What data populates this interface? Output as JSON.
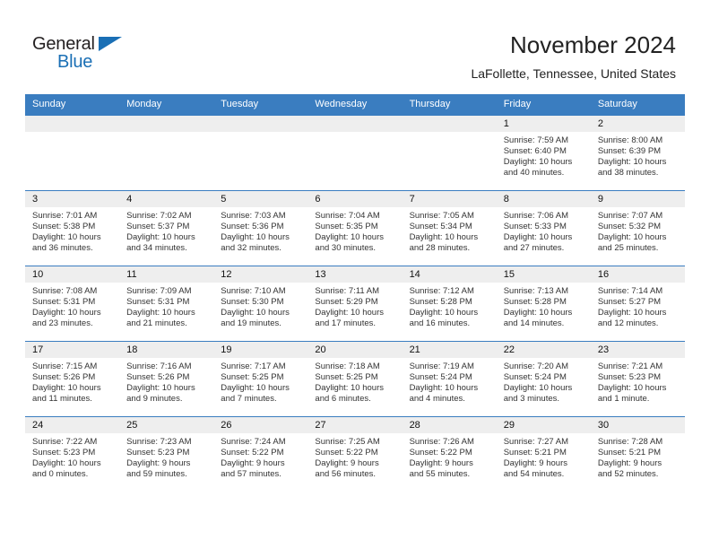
{
  "brand": {
    "name_part1": "General",
    "name_part2": "Blue",
    "accent_color": "#1a6fb5"
  },
  "header": {
    "month_title": "November 2024",
    "location": "LaFollette, Tennessee, United States"
  },
  "calendar": {
    "header_bg_color": "#3a7dc0",
    "daynum_bg_color": "#eeeeee",
    "weekday_headers": [
      "Sunday",
      "Monday",
      "Tuesday",
      "Wednesday",
      "Thursday",
      "Friday",
      "Saturday"
    ],
    "labels": {
      "sunrise_prefix": "Sunrise:",
      "sunset_prefix": "Sunset:",
      "daylight_prefix": "Daylight:"
    },
    "weeks": [
      [
        {
          "day": "",
          "empty": true
        },
        {
          "day": "",
          "empty": true
        },
        {
          "day": "",
          "empty": true
        },
        {
          "day": "",
          "empty": true
        },
        {
          "day": "",
          "empty": true
        },
        {
          "day": "1",
          "sunrise": "Sunrise: 7:59 AM",
          "sunset": "Sunset: 6:40 PM",
          "daylight_line1": "Daylight: 10 hours",
          "daylight_line2": "and 40 minutes."
        },
        {
          "day": "2",
          "sunrise": "Sunrise: 8:00 AM",
          "sunset": "Sunset: 6:39 PM",
          "daylight_line1": "Daylight: 10 hours",
          "daylight_line2": "and 38 minutes."
        }
      ],
      [
        {
          "day": "3",
          "sunrise": "Sunrise: 7:01 AM",
          "sunset": "Sunset: 5:38 PM",
          "daylight_line1": "Daylight: 10 hours",
          "daylight_line2": "and 36 minutes."
        },
        {
          "day": "4",
          "sunrise": "Sunrise: 7:02 AM",
          "sunset": "Sunset: 5:37 PM",
          "daylight_line1": "Daylight: 10 hours",
          "daylight_line2": "and 34 minutes."
        },
        {
          "day": "5",
          "sunrise": "Sunrise: 7:03 AM",
          "sunset": "Sunset: 5:36 PM",
          "daylight_line1": "Daylight: 10 hours",
          "daylight_line2": "and 32 minutes."
        },
        {
          "day": "6",
          "sunrise": "Sunrise: 7:04 AM",
          "sunset": "Sunset: 5:35 PM",
          "daylight_line1": "Daylight: 10 hours",
          "daylight_line2": "and 30 minutes."
        },
        {
          "day": "7",
          "sunrise": "Sunrise: 7:05 AM",
          "sunset": "Sunset: 5:34 PM",
          "daylight_line1": "Daylight: 10 hours",
          "daylight_line2": "and 28 minutes."
        },
        {
          "day": "8",
          "sunrise": "Sunrise: 7:06 AM",
          "sunset": "Sunset: 5:33 PM",
          "daylight_line1": "Daylight: 10 hours",
          "daylight_line2": "and 27 minutes."
        },
        {
          "day": "9",
          "sunrise": "Sunrise: 7:07 AM",
          "sunset": "Sunset: 5:32 PM",
          "daylight_line1": "Daylight: 10 hours",
          "daylight_line2": "and 25 minutes."
        }
      ],
      [
        {
          "day": "10",
          "sunrise": "Sunrise: 7:08 AM",
          "sunset": "Sunset: 5:31 PM",
          "daylight_line1": "Daylight: 10 hours",
          "daylight_line2": "and 23 minutes."
        },
        {
          "day": "11",
          "sunrise": "Sunrise: 7:09 AM",
          "sunset": "Sunset: 5:31 PM",
          "daylight_line1": "Daylight: 10 hours",
          "daylight_line2": "and 21 minutes."
        },
        {
          "day": "12",
          "sunrise": "Sunrise: 7:10 AM",
          "sunset": "Sunset: 5:30 PM",
          "daylight_line1": "Daylight: 10 hours",
          "daylight_line2": "and 19 minutes."
        },
        {
          "day": "13",
          "sunrise": "Sunrise: 7:11 AM",
          "sunset": "Sunset: 5:29 PM",
          "daylight_line1": "Daylight: 10 hours",
          "daylight_line2": "and 17 minutes."
        },
        {
          "day": "14",
          "sunrise": "Sunrise: 7:12 AM",
          "sunset": "Sunset: 5:28 PM",
          "daylight_line1": "Daylight: 10 hours",
          "daylight_line2": "and 16 minutes."
        },
        {
          "day": "15",
          "sunrise": "Sunrise: 7:13 AM",
          "sunset": "Sunset: 5:28 PM",
          "daylight_line1": "Daylight: 10 hours",
          "daylight_line2": "and 14 minutes."
        },
        {
          "day": "16",
          "sunrise": "Sunrise: 7:14 AM",
          "sunset": "Sunset: 5:27 PM",
          "daylight_line1": "Daylight: 10 hours",
          "daylight_line2": "and 12 minutes."
        }
      ],
      [
        {
          "day": "17",
          "sunrise": "Sunrise: 7:15 AM",
          "sunset": "Sunset: 5:26 PM",
          "daylight_line1": "Daylight: 10 hours",
          "daylight_line2": "and 11 minutes."
        },
        {
          "day": "18",
          "sunrise": "Sunrise: 7:16 AM",
          "sunset": "Sunset: 5:26 PM",
          "daylight_line1": "Daylight: 10 hours",
          "daylight_line2": "and 9 minutes."
        },
        {
          "day": "19",
          "sunrise": "Sunrise: 7:17 AM",
          "sunset": "Sunset: 5:25 PM",
          "daylight_line1": "Daylight: 10 hours",
          "daylight_line2": "and 7 minutes."
        },
        {
          "day": "20",
          "sunrise": "Sunrise: 7:18 AM",
          "sunset": "Sunset: 5:25 PM",
          "daylight_line1": "Daylight: 10 hours",
          "daylight_line2": "and 6 minutes."
        },
        {
          "day": "21",
          "sunrise": "Sunrise: 7:19 AM",
          "sunset": "Sunset: 5:24 PM",
          "daylight_line1": "Daylight: 10 hours",
          "daylight_line2": "and 4 minutes."
        },
        {
          "day": "22",
          "sunrise": "Sunrise: 7:20 AM",
          "sunset": "Sunset: 5:24 PM",
          "daylight_line1": "Daylight: 10 hours",
          "daylight_line2": "and 3 minutes."
        },
        {
          "day": "23",
          "sunrise": "Sunrise: 7:21 AM",
          "sunset": "Sunset: 5:23 PM",
          "daylight_line1": "Daylight: 10 hours",
          "daylight_line2": "and 1 minute."
        }
      ],
      [
        {
          "day": "24",
          "sunrise": "Sunrise: 7:22 AM",
          "sunset": "Sunset: 5:23 PM",
          "daylight_line1": "Daylight: 10 hours",
          "daylight_line2": "and 0 minutes."
        },
        {
          "day": "25",
          "sunrise": "Sunrise: 7:23 AM",
          "sunset": "Sunset: 5:23 PM",
          "daylight_line1": "Daylight: 9 hours",
          "daylight_line2": "and 59 minutes."
        },
        {
          "day": "26",
          "sunrise": "Sunrise: 7:24 AM",
          "sunset": "Sunset: 5:22 PM",
          "daylight_line1": "Daylight: 9 hours",
          "daylight_line2": "and 57 minutes."
        },
        {
          "day": "27",
          "sunrise": "Sunrise: 7:25 AM",
          "sunset": "Sunset: 5:22 PM",
          "daylight_line1": "Daylight: 9 hours",
          "daylight_line2": "and 56 minutes."
        },
        {
          "day": "28",
          "sunrise": "Sunrise: 7:26 AM",
          "sunset": "Sunset: 5:22 PM",
          "daylight_line1": "Daylight: 9 hours",
          "daylight_line2": "and 55 minutes."
        },
        {
          "day": "29",
          "sunrise": "Sunrise: 7:27 AM",
          "sunset": "Sunset: 5:21 PM",
          "daylight_line1": "Daylight: 9 hours",
          "daylight_line2": "and 54 minutes."
        },
        {
          "day": "30",
          "sunrise": "Sunrise: 7:28 AM",
          "sunset": "Sunset: 5:21 PM",
          "daylight_line1": "Daylight: 9 hours",
          "daylight_line2": "and 52 minutes."
        }
      ]
    ]
  }
}
